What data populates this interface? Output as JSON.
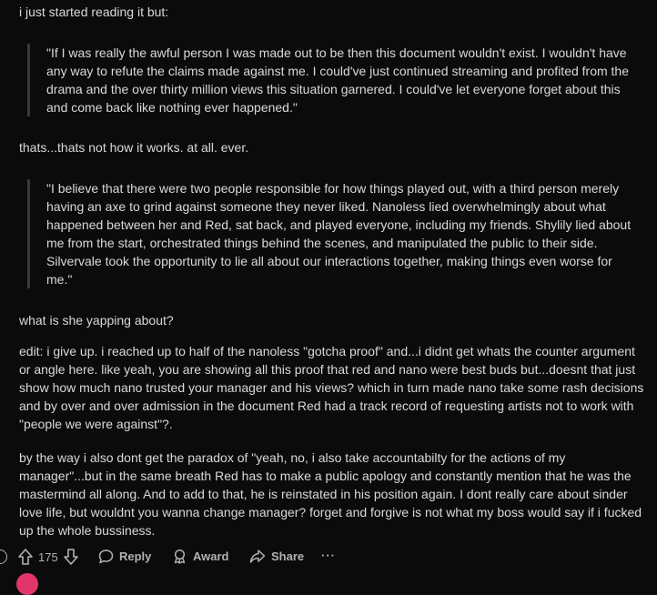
{
  "comment": {
    "paragraphs": [
      "i just started reading it but:",
      "thats...thats not how it works. at all. ever.",
      "what is she yapping about?",
      "edit: i give up. i reached up to half of the nanoless \"gotcha proof\" and...i didnt get whats the counter argument or angle here. like yeah, you are showing all this proof that red and nano were best buds but...doesnt that just show how much nano trusted your manager and his views? which in turn made nano take some rash decisions and by over and over admission in the document Red had a track record of requesting artists not to work with \"people we were against\"?.",
      "by the way i also dont get the paradox of \"yeah, no, i also take accountabilty for the actions of my manager\"...but in the same breath Red has to make a public apology and constantly mention that he was the mastermind all along. And to add to that, he is reinstated in his position again. I dont really care about sinder love life, but wouldnt you wanna change manager? forget and forgive is not what my boss would say if i fucked up the whole bussiness."
    ],
    "quotes": [
      "\"If I was really the awful person I was made out to be then this document wouldn't exist. I wouldn't have any way to refute the claims made against me. I could've just continued streaming and profited from the drama and the over thirty million views this situation garnered. I could've let everyone forget about this and come back like nothing ever happened.\"",
      "\"I believe that there were two people responsible for how things played out, with a third person merely having an axe to grind against someone they never liked. Nanoless lied overwhelmingly about what happened between her and Red, sat back, and played everyone, including my friends. Shylily lied about me from the start, orchestrated things behind the scenes, and manipulated the public to their side. Silvervale took the opportunity to lie all about our interactions together, making things even worse for me.\""
    ]
  },
  "actions": {
    "vote_count": "175",
    "reply_label": "Reply",
    "award_label": "Award",
    "share_label": "Share",
    "more_label": "···"
  },
  "icons": {
    "upvote": "upvote-arrow-icon",
    "downvote": "downvote-arrow-icon",
    "reply": "speech-bubble-icon",
    "award": "award-ribbon-icon",
    "share": "share-arrow-icon"
  }
}
